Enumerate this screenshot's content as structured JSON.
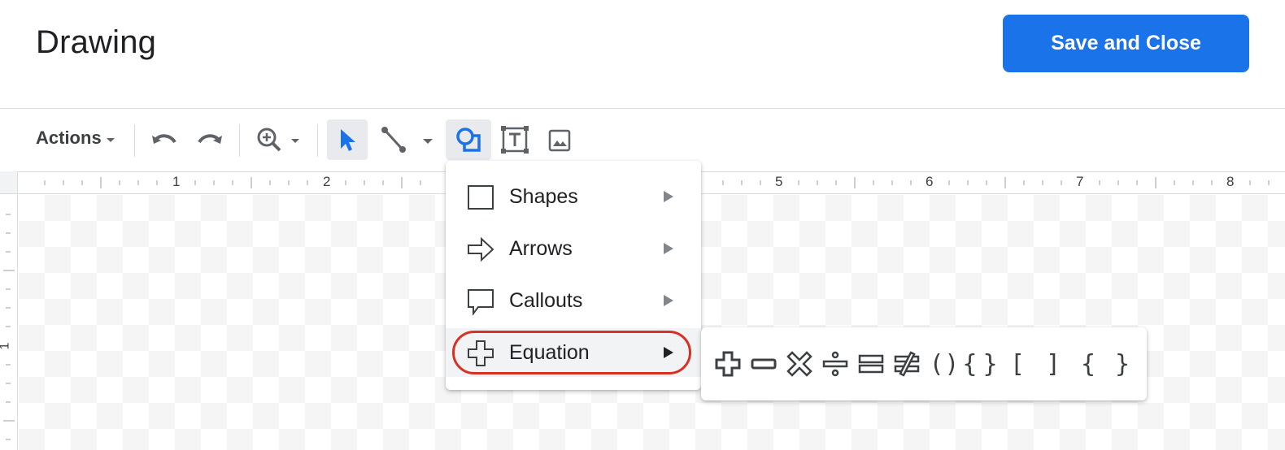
{
  "header": {
    "title": "Drawing",
    "save_label": "Save and Close",
    "accent_color": "#1a73e8"
  },
  "toolbar": {
    "actions_label": "Actions",
    "icons": [
      "undo-icon",
      "redo-icon",
      "zoom-icon",
      "select-arrow-icon",
      "line-icon",
      "shape-icon",
      "text-box-icon",
      "image-icon"
    ]
  },
  "ruler": {
    "numbers": [
      "1",
      "2",
      "5",
      "6",
      "7",
      "8"
    ],
    "left_numbers": [
      "1"
    ]
  },
  "menu": {
    "items": [
      {
        "label": "Shapes",
        "icon": "square-outline-icon"
      },
      {
        "label": "Arrows",
        "icon": "arrow-outline-icon"
      },
      {
        "label": "Callouts",
        "icon": "callout-outline-icon"
      },
      {
        "label": "Equation",
        "icon": "plus-outline-icon"
      }
    ],
    "highlight_color": "#d93025"
  },
  "submenu": {
    "items": [
      {
        "name": "plus-icon"
      },
      {
        "name": "minus-icon"
      },
      {
        "name": "multiply-icon"
      },
      {
        "name": "divide-icon"
      },
      {
        "name": "equal-icon"
      },
      {
        "name": "not-equal-icon"
      },
      {
        "name": "parentheses-icon",
        "text": "()"
      },
      {
        "name": "braces-icon",
        "text": "{}"
      },
      {
        "name": "left-bracket-icon",
        "text": "["
      },
      {
        "name": "right-bracket-icon",
        "text": "]"
      },
      {
        "name": "left-brace-icon",
        "text": "{"
      },
      {
        "name": "right-brace-icon",
        "text": "}"
      }
    ]
  }
}
